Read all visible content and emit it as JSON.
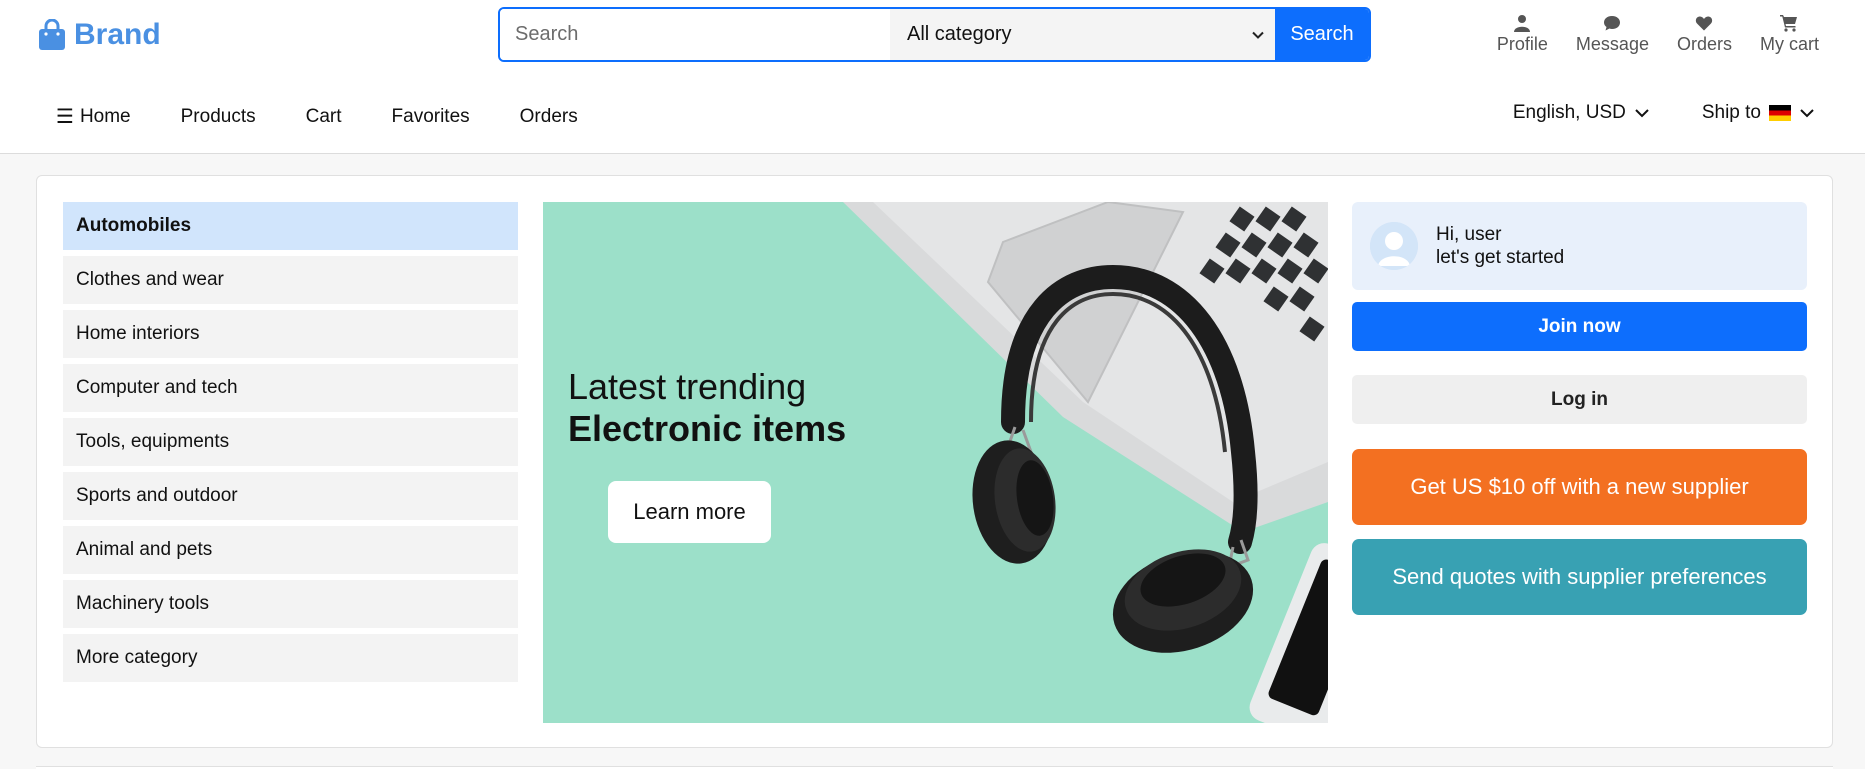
{
  "brand": {
    "name": "Brand",
    "color": "#4a90e2"
  },
  "search": {
    "placeholder": "Search",
    "value": "",
    "category_selected": "All category",
    "button_label": "Search"
  },
  "header_actions": [
    {
      "label": "Profile",
      "icon": "user-icon"
    },
    {
      "label": "Message",
      "icon": "message-icon"
    },
    {
      "label": "Orders",
      "icon": "heart-icon"
    },
    {
      "label": "My cart",
      "icon": "cart-icon"
    }
  ],
  "nav": {
    "menu_icon": "☰",
    "links": [
      "Home",
      "Products",
      "Cart",
      "Favorites",
      "Orders"
    ],
    "language_currency": "English, USD",
    "ship_to_label": "Ship to",
    "ship_to_flag": "germany-flag"
  },
  "categories": {
    "items": [
      "Automobiles",
      "Clothes and wear",
      "Home interiors",
      "Computer and tech",
      "Tools, equipments",
      "Sports and outdoor",
      "Animal and pets",
      "Machinery tools",
      "More category"
    ],
    "active_index": 0
  },
  "banner": {
    "line1": "Latest trending",
    "line2": "Electronic items",
    "cta_label": "Learn more",
    "background_color": "#9ce0c9"
  },
  "side_panel": {
    "greeting_line1": "Hi, user",
    "greeting_line2": "let's get started",
    "join_label": "Join now",
    "login_label": "Log in",
    "offer_label": "Get US $10 off with a new supplier",
    "quotes_label": "Send quotes with supplier preferences"
  },
  "colors": {
    "primary": "#0d6efd",
    "offer": "#f37021",
    "quotes": "#38a1b3",
    "active_category": "#d1e5fc"
  }
}
